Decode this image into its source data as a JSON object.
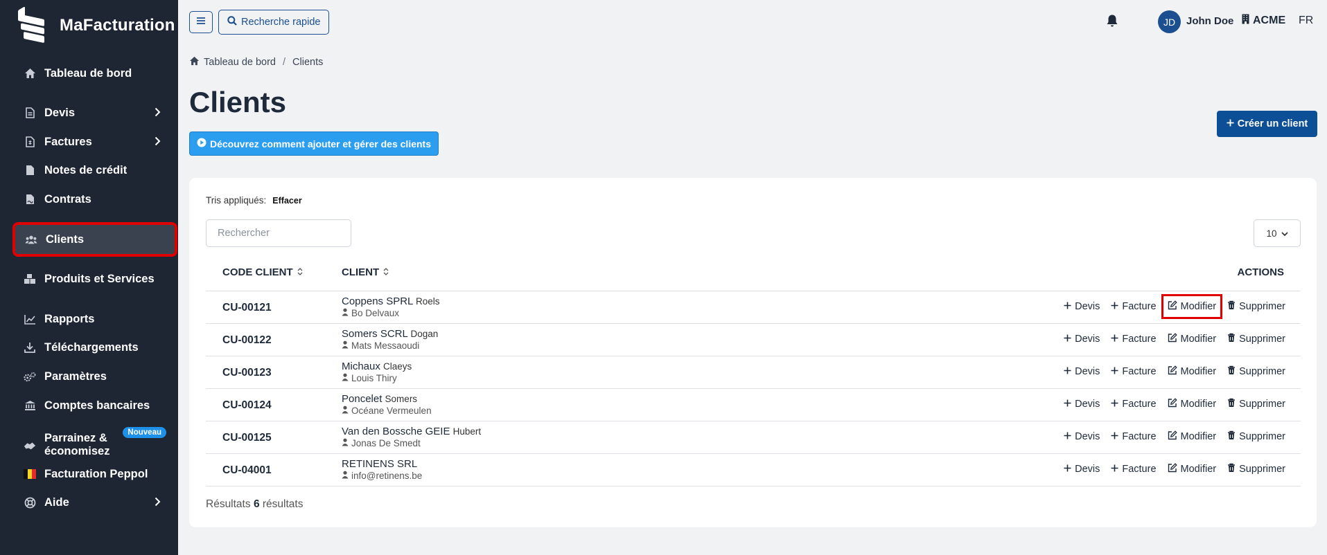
{
  "app": {
    "brand": "MaFacturation"
  },
  "sidebar": {
    "items": [
      {
        "label": "Tableau de bord",
        "icon": "home-icon"
      },
      {
        "label": "Devis",
        "icon": "document-icon",
        "has_submenu": true
      },
      {
        "label": "Factures",
        "icon": "invoice-icon",
        "has_submenu": true
      },
      {
        "label": "Notes de crédit",
        "icon": "credit-note-icon"
      },
      {
        "label": "Contrats",
        "icon": "contract-icon"
      },
      {
        "label": "Clients",
        "icon": "users-icon",
        "active": true
      },
      {
        "label": "Produits et Services",
        "icon": "boxes-icon"
      },
      {
        "label": "Rapports",
        "icon": "chart-icon"
      },
      {
        "label": "Téléchargements",
        "icon": "download-icon"
      },
      {
        "label": "Paramètres",
        "icon": "gears-icon"
      },
      {
        "label": "Comptes bancaires",
        "icon": "bank-icon"
      },
      {
        "label": "Parrainez & économisez",
        "icon": "handshake-icon",
        "badge": "Nouveau"
      },
      {
        "label": "Facturation Peppol",
        "icon": "belgian-flag-icon"
      },
      {
        "label": "Aide",
        "icon": "lifebuoy-icon",
        "has_submenu": true
      }
    ]
  },
  "topbar": {
    "quick_search_label": "Recherche rapide",
    "user_initials": "JD",
    "user_name": "John Doe",
    "company": "ACME",
    "language": "FR"
  },
  "breadcrumb": {
    "home": "Tableau de bord",
    "current": "Clients"
  },
  "page": {
    "title": "Clients",
    "help_button": "Découvrez comment ajouter et gérer des clients",
    "create_button": "Créer un client"
  },
  "table": {
    "sorts_label": "Tris appliqués:",
    "clear_label": "Effacer",
    "search_placeholder": "Rechercher",
    "per_page": "10",
    "columns": {
      "code": "CODE CLIENT",
      "client": "CLIENT",
      "actions": "ACTIONS"
    },
    "action_labels": {
      "quote": "Devis",
      "invoice": "Facture",
      "edit": "Modifier",
      "delete": "Supprimer"
    },
    "rows": [
      {
        "code": "CU-00121",
        "name": "Coppens SPRL",
        "sub": "Roels",
        "contact": "Bo Delvaux"
      },
      {
        "code": "CU-00122",
        "name": "Somers SCRL",
        "sub": "Dogan",
        "contact": "Mats Messaoudi"
      },
      {
        "code": "CU-00123",
        "name": "Michaux",
        "sub": "Claeys",
        "contact": "Louis Thiry"
      },
      {
        "code": "CU-00124",
        "name": "Poncelet",
        "sub": "Somers",
        "contact": "Océane Vermeulen"
      },
      {
        "code": "CU-00125",
        "name": "Van den Bossche GEIE",
        "sub": "Hubert",
        "contact": "Jonas De Smedt"
      },
      {
        "code": "CU-04001",
        "name": "RETINENS SRL",
        "sub": "",
        "contact": "info@retinens.be"
      }
    ],
    "results_prefix": "Résultats",
    "results_count": "6",
    "results_suffix": "résultats"
  },
  "colors": {
    "sidebar_bg": "#1e2633",
    "primary": "#0c4f96",
    "info": "#2b9ef0",
    "highlight": "#e00000"
  }
}
